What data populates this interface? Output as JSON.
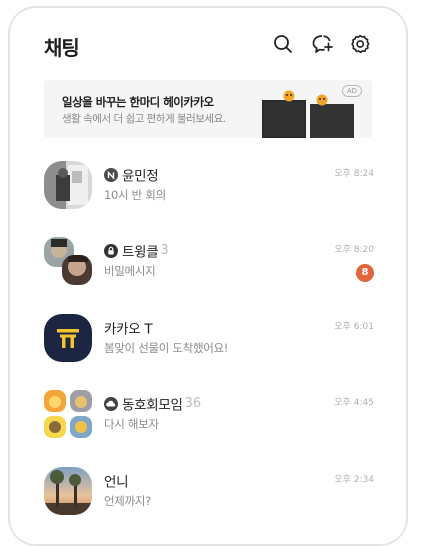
{
  "header": {
    "title": "채팅",
    "icons": [
      "search-icon",
      "new-chat-icon",
      "settings-icon"
    ]
  },
  "ad": {
    "title": "일상을 바꾸는 한마디 헤이카카오",
    "subtitle": "생활 속에서 더 쉽고 편하게 불러보세요.",
    "badge": "AD"
  },
  "chats": [
    {
      "name": "윤민정",
      "message": "10시 반 회의",
      "time": "오후 8:24",
      "status_icon": "n-circle-icon"
    },
    {
      "name": "트윙클",
      "count": "3",
      "message": "비밀메시지",
      "time": "오후 8:20",
      "unread": "8",
      "status_icon": "lock-circle-icon"
    },
    {
      "name": "카카오 T",
      "message": "봄맞이 선물이 도착했어요!",
      "time": "오후 6:01"
    },
    {
      "name": "동호회모임",
      "count": "36",
      "message": "다시 해보자",
      "time": "오후 4:45",
      "status_icon": "cloud-circle-icon"
    },
    {
      "name": "언니",
      "message": "언제까지?",
      "time": "오후 2:34"
    }
  ],
  "colors": {
    "unread_badge": "#e2653b",
    "kakao_t_bg": "#1c2542",
    "kakao_t_logo": "#f4c42d"
  }
}
